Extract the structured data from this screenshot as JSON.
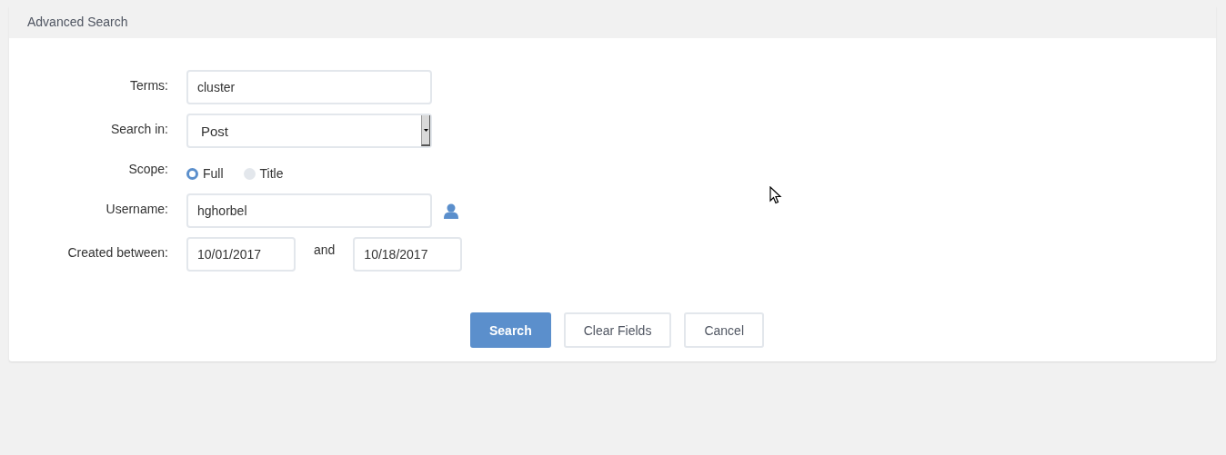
{
  "panel": {
    "title": "Advanced Search"
  },
  "form": {
    "terms": {
      "label": "Terms:",
      "value": "cluster"
    },
    "search_in": {
      "label": "Search in:",
      "value": "Post"
    },
    "scope": {
      "label": "Scope:",
      "options": [
        {
          "label": "Full",
          "selected": true
        },
        {
          "label": "Title",
          "selected": false
        }
      ]
    },
    "username": {
      "label": "Username:",
      "value": "hghorbel"
    },
    "created_between": {
      "label": "Created between:",
      "from": "10/01/2017",
      "joiner": "and",
      "to": "10/18/2017"
    }
  },
  "buttons": [
    {
      "label": "Search",
      "kind": "primary"
    },
    {
      "label": "Clear Fields",
      "kind": "default"
    },
    {
      "label": "Cancel",
      "kind": "default"
    }
  ]
}
